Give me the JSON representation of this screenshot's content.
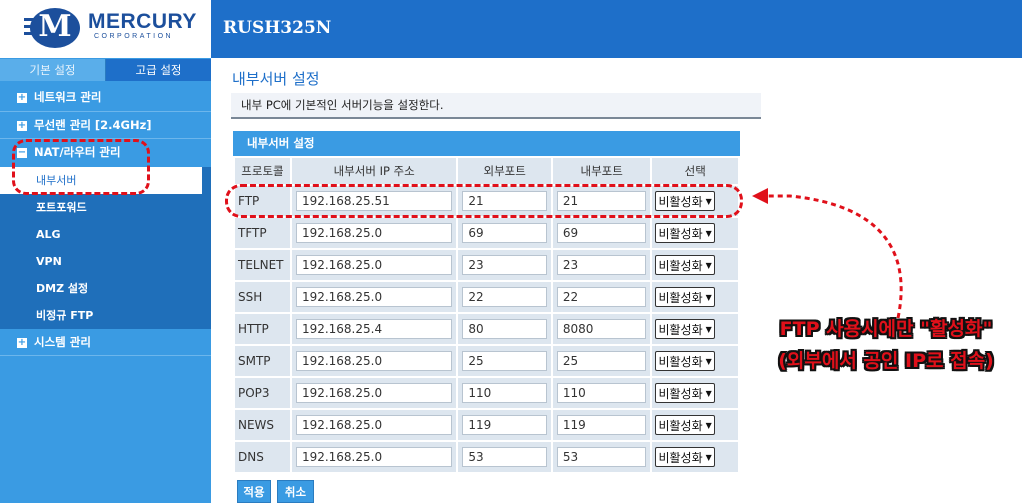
{
  "header": {
    "brand": "MERCURY",
    "brand_sub": "CORPORATION",
    "model": "RUSH325N"
  },
  "sidebar": {
    "tabs": [
      {
        "label": "기본 설정"
      },
      {
        "label": "고급 설정"
      }
    ],
    "items": [
      {
        "label": "네트워크 관리",
        "icon": "plus-icon"
      },
      {
        "label": "무선랜 관리 [2.4GHz]",
        "icon": "plus-icon"
      },
      {
        "label": "NAT/라우터 관리",
        "icon": "minus-icon"
      },
      {
        "label": "시스템 관리",
        "icon": "plus-icon"
      }
    ],
    "submenu": [
      {
        "label": "내부서버"
      },
      {
        "label": "포트포워드"
      },
      {
        "label": "ALG"
      },
      {
        "label": "VPN"
      },
      {
        "label": "DMZ 설정"
      },
      {
        "label": "비정규 FTP"
      }
    ]
  },
  "main": {
    "title": "내부서버 설정",
    "description": "내부 PC에 기본적인 서버기능을 설정한다.",
    "panel_title": "내부서버 설정",
    "columns": [
      "프로토콜",
      "내부서버 IP 주소",
      "외부포트",
      "내부포트",
      "선택"
    ],
    "rows": [
      {
        "protocol": "FTP",
        "ip": "192.168.25.51",
        "ext": "21",
        "int": "21",
        "select": "비활성화"
      },
      {
        "protocol": "TFTP",
        "ip": "192.168.25.0",
        "ext": "69",
        "int": "69",
        "select": "비활성화"
      },
      {
        "protocol": "TELNET",
        "ip": "192.168.25.0",
        "ext": "23",
        "int": "23",
        "select": "비활성화"
      },
      {
        "protocol": "SSH",
        "ip": "192.168.25.0",
        "ext": "22",
        "int": "22",
        "select": "비활성화"
      },
      {
        "protocol": "HTTP",
        "ip": "192.168.25.4",
        "ext": "80",
        "int": "8080",
        "select": "비활성화"
      },
      {
        "protocol": "SMTP",
        "ip": "192.168.25.0",
        "ext": "25",
        "int": "25",
        "select": "비활성화"
      },
      {
        "protocol": "POP3",
        "ip": "192.168.25.0",
        "ext": "110",
        "int": "110",
        "select": "비활성화"
      },
      {
        "protocol": "NEWS",
        "ip": "192.168.25.0",
        "ext": "119",
        "int": "119",
        "select": "비활성화"
      },
      {
        "protocol": "DNS",
        "ip": "192.168.25.0",
        "ext": "53",
        "int": "53",
        "select": "비활성화"
      }
    ],
    "buttons": {
      "apply": "적용",
      "cancel": "취소"
    }
  },
  "annotation": {
    "line1": "FTP 사용시에만 \"활성화\"",
    "line2": "(외부에서  공인 IP로 접속)"
  },
  "colors": {
    "topbar": "#1e6fc9",
    "sidebar": "#3a9be3",
    "annotation_red": "#e0101a"
  }
}
